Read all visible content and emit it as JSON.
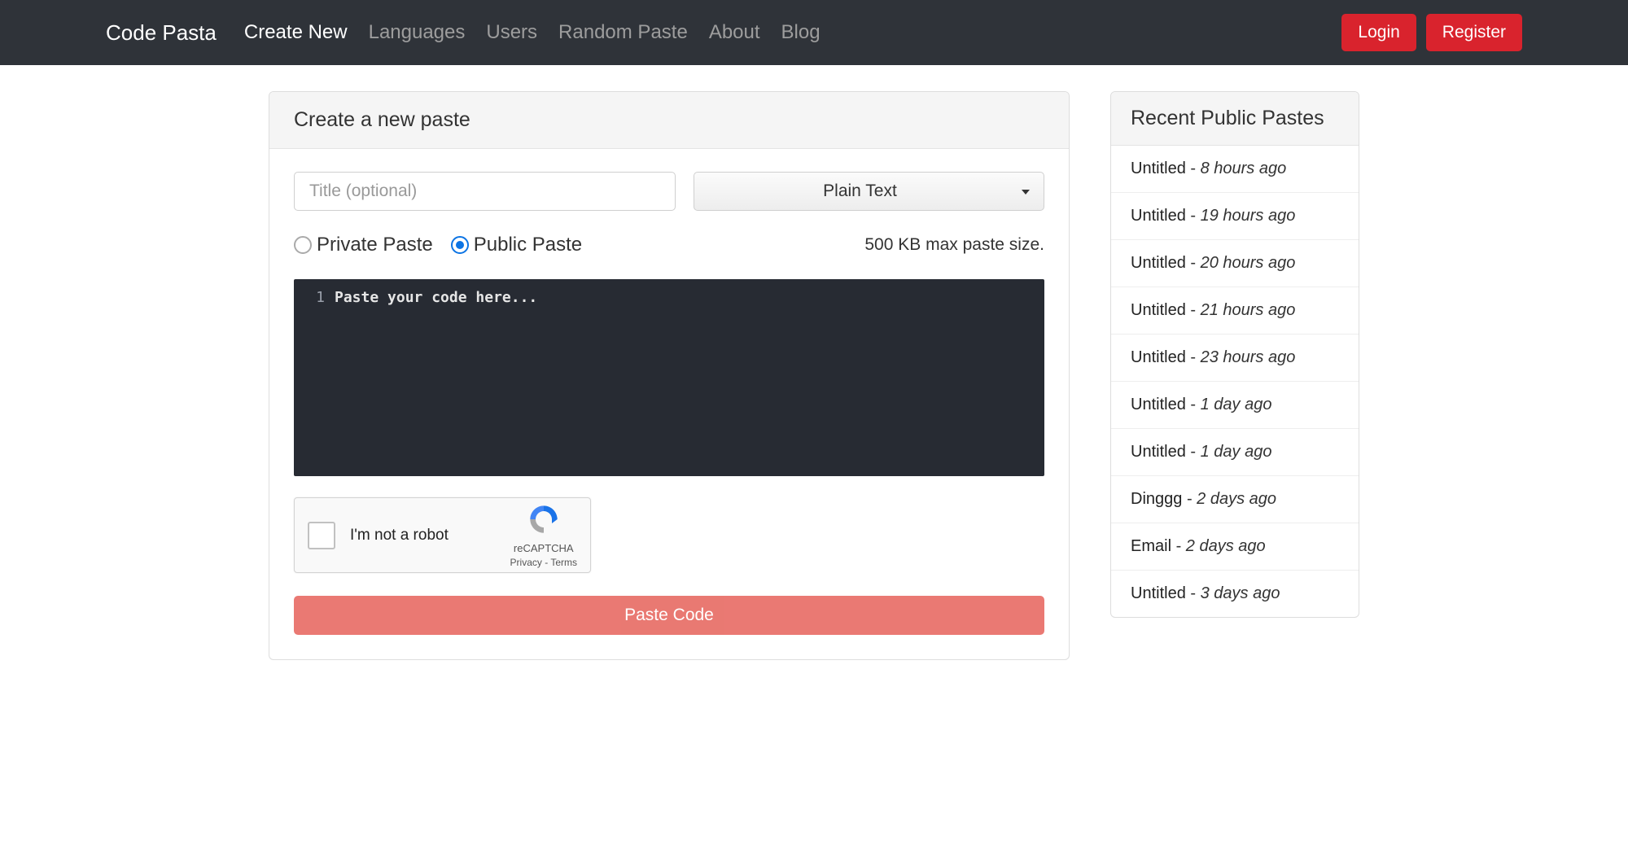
{
  "nav": {
    "brand": "Code Pasta",
    "items": [
      {
        "label": "Create New",
        "active": true
      },
      {
        "label": "Languages",
        "active": false
      },
      {
        "label": "Users",
        "active": false
      },
      {
        "label": "Random Paste",
        "active": false
      },
      {
        "label": "About",
        "active": false
      },
      {
        "label": "Blog",
        "active": false
      }
    ],
    "login": "Login",
    "register": "Register"
  },
  "form": {
    "heading": "Create a new paste",
    "title_placeholder": "Title (optional)",
    "language_selected": "Plain Text",
    "private_label": "Private Paste",
    "public_label": "Public Paste",
    "size_note": "500 KB max paste size.",
    "editor_placeholder": "Paste your code here...",
    "editor_line_number": "1",
    "submit_label": "Paste Code"
  },
  "recaptcha": {
    "label": "I'm not a robot",
    "brand": "reCAPTCHA",
    "links": "Privacy - Terms"
  },
  "sidebar": {
    "heading": "Recent Public Pastes",
    "items": [
      {
        "title": "Untitled",
        "time": "8 hours ago"
      },
      {
        "title": "Untitled",
        "time": "19 hours ago"
      },
      {
        "title": "Untitled",
        "time": "20 hours ago"
      },
      {
        "title": "Untitled",
        "time": "21 hours ago"
      },
      {
        "title": "Untitled",
        "time": "23 hours ago"
      },
      {
        "title": "Untitled",
        "time": "1 day ago"
      },
      {
        "title": "Untitled",
        "time": "1 day ago"
      },
      {
        "title": "Dinggg",
        "time": "2 days ago"
      },
      {
        "title": "Email",
        "time": "2 days ago"
      },
      {
        "title": "Untitled",
        "time": "3 days ago"
      }
    ]
  }
}
